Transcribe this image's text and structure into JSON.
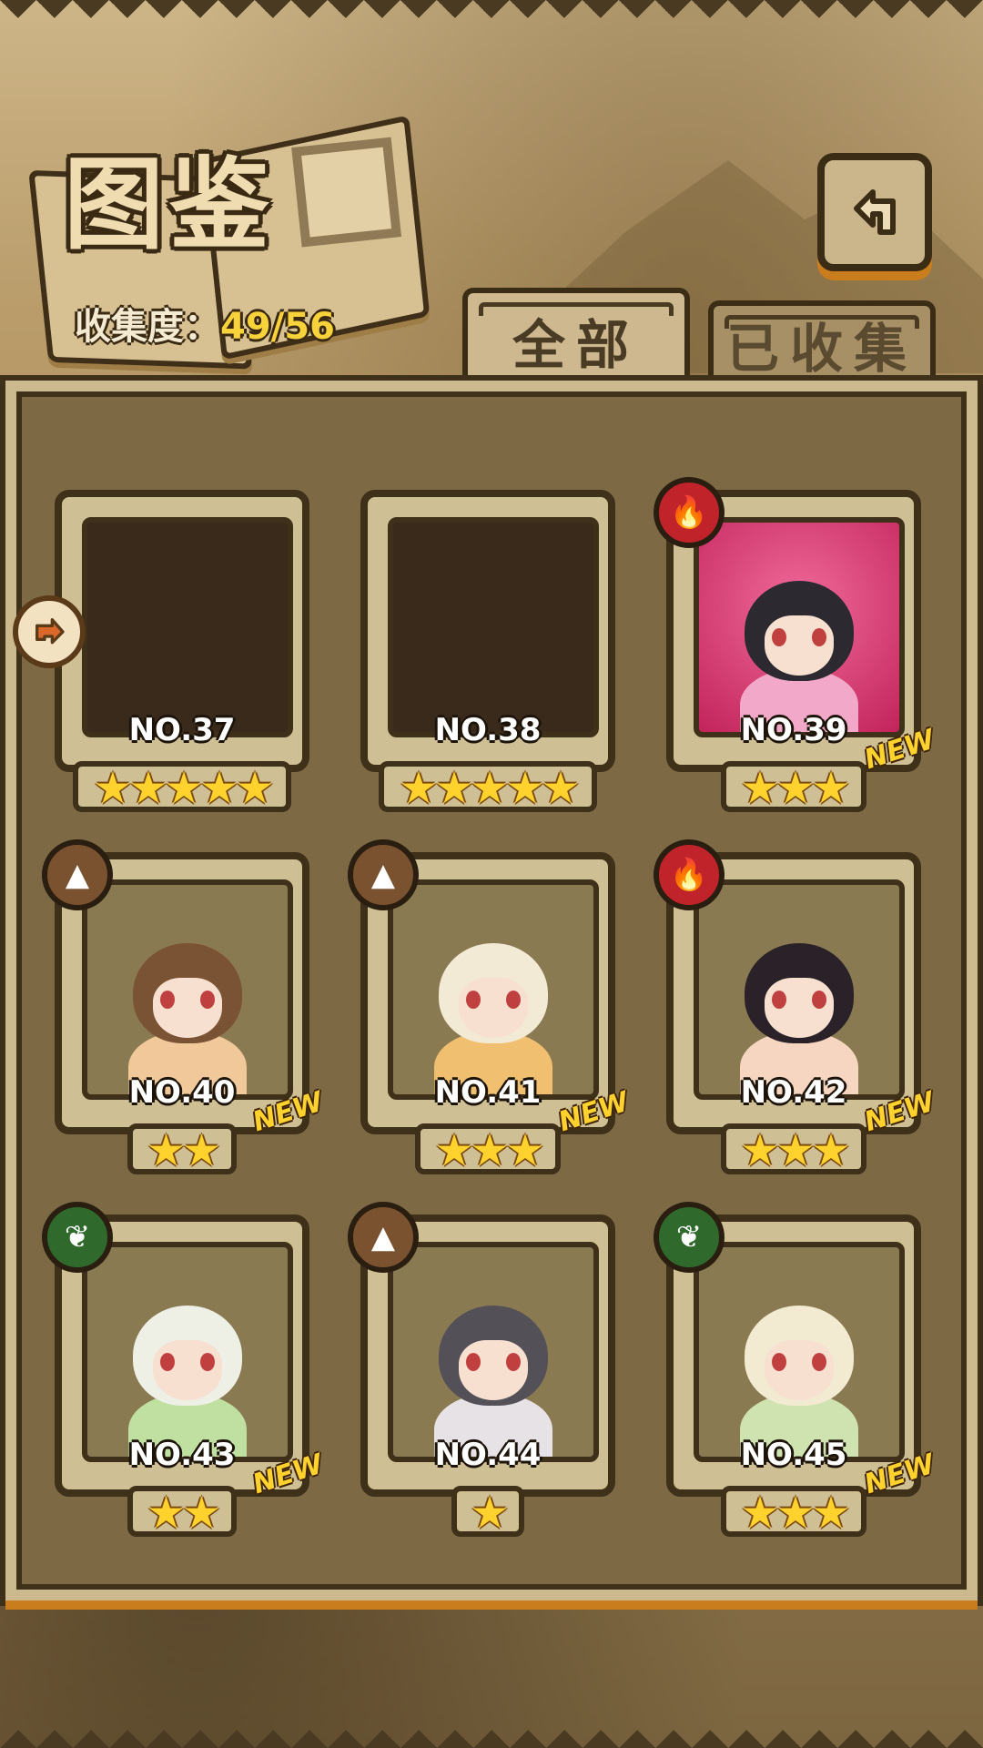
{
  "header": {
    "title": "图鉴",
    "collection_label": "收集度：",
    "collection_value": "49/56"
  },
  "tabs": [
    {
      "label": "全部",
      "active": true
    },
    {
      "label": "已收集",
      "active": false
    }
  ],
  "cards": [
    {
      "no": "NO.37",
      "stars": 5,
      "collected": false,
      "new": false,
      "element": null
    },
    {
      "no": "NO.38",
      "stars": 5,
      "collected": false,
      "new": false,
      "element": null
    },
    {
      "no": "NO.39",
      "stars": 3,
      "collected": true,
      "new": true,
      "element": "fire"
    },
    {
      "no": "NO.40",
      "stars": 2,
      "collected": true,
      "new": true,
      "element": "earth"
    },
    {
      "no": "NO.41",
      "stars": 3,
      "collected": true,
      "new": true,
      "element": "earth"
    },
    {
      "no": "NO.42",
      "stars": 3,
      "collected": true,
      "new": true,
      "element": "fire"
    },
    {
      "no": "NO.43",
      "stars": 2,
      "collected": true,
      "new": true,
      "element": "wood"
    },
    {
      "no": "NO.44",
      "stars": 1,
      "collected": true,
      "new": false,
      "element": "earth"
    },
    {
      "no": "NO.45",
      "stars": 3,
      "collected": true,
      "new": true,
      "element": "wood"
    }
  ],
  "new_label": "NEW",
  "colors": {
    "fire": "#c0232a",
    "earth": "#7a5230",
    "wood": "#2f6a2c",
    "star": "#ffd22e",
    "accent_orange": "#c97d1c"
  },
  "icons": {
    "back": "back-arrow-icon",
    "side": "side-arrow-icon",
    "fire": "flame-icon",
    "earth": "mountain-icon",
    "wood": "leaf-icon"
  }
}
